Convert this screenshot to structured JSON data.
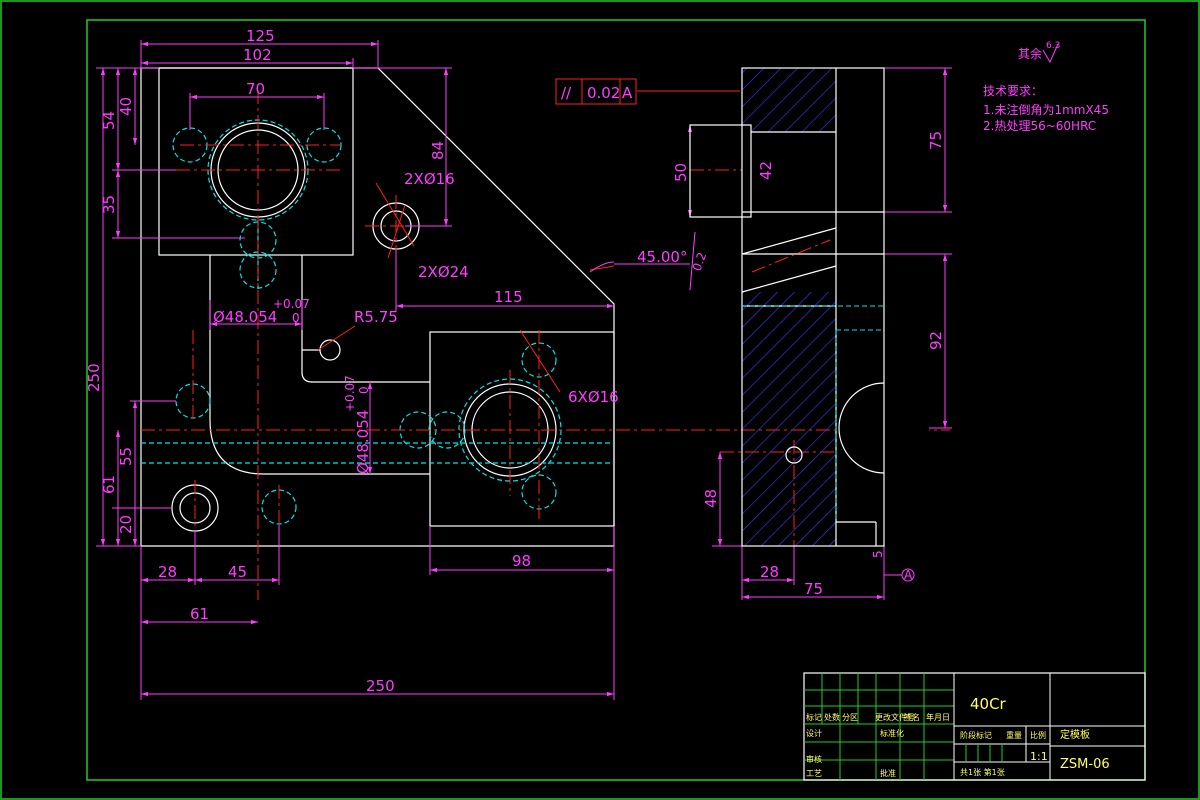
{
  "dimensions": {
    "top_125": "125",
    "top_102": "102",
    "d70": "70",
    "d84": "84",
    "left_54": "54",
    "left_40": "40",
    "left_35": "35",
    "left_250": "250",
    "left_55": "55",
    "left_61": "61",
    "left_20": "20",
    "bottom_28": "28",
    "bottom_45": "45",
    "bottom_61": "61",
    "bottom_98": "98",
    "bottom_250": "250",
    "d115": "115",
    "d45deg": "45.00°",
    "hole_2x16": "2XØ16",
    "hole_2x24": "2XØ24",
    "hole_6x16": "6XØ16",
    "r575": "R5.75",
    "bore_a": "Ø48.054",
    "bore_a_tol_up": "+0.07",
    "bore_a_tol_low": "0",
    "bore_b": "Ø48.054",
    "bore_b_tol_up": "+0.07",
    "bore_b_tol_low": "0",
    "side_50": "50",
    "side_42": "42",
    "side_75": "75",
    "side_92": "92",
    "side_48": "48",
    "side_28": "28",
    "side_75b": "75",
    "side_5": "5",
    "side_02": "0.2",
    "tol_sym": "//",
    "tol_val": "0.02",
    "tol_datum": "A",
    "datum_mark": "A"
  },
  "notes": {
    "roughness": "其余",
    "roughness_val": "6.3",
    "line1": "技术要求：",
    "line2": "1.未注倒角为1mmX45",
    "line3": "2.热处理56~60HRC"
  },
  "title_block": {
    "material": "40Cr",
    "part_name": "定模板",
    "drawing_no": "ZSM-06",
    "scale": "1:1",
    "row_labels": [
      "标记",
      "处数",
      "分区",
      "更改文件号",
      "签名",
      "年月日"
    ],
    "left_labels": [
      "设计",
      "审核",
      "工艺"
    ],
    "mid_label": "标准化",
    "mid_label2": "批准",
    "stage_label": "阶段标记",
    "weight_label": "重量",
    "scale_label": "比例",
    "sheets": "共1张  第1张"
  },
  "colors": {
    "outline": "#ffffff",
    "dimension": "#ff3cff",
    "leader": "#ff2020",
    "hidden": "#00e5e5",
    "hatch": "#3c3cff",
    "frame": "#22cc22",
    "titletext": "#ffff66"
  }
}
